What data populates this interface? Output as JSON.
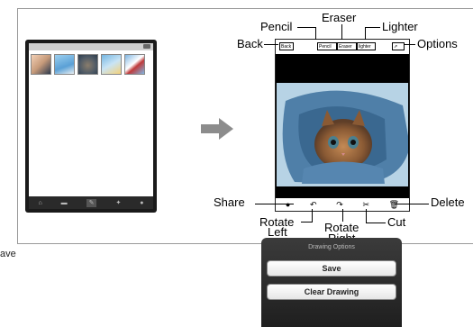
{
  "callouts": {
    "pencil": "Pencil",
    "eraser": "Eraser",
    "lighter": "Lighter",
    "back": "Back",
    "options": "Options",
    "share": "Share",
    "rotate_left": [
      "Rotate",
      "Left"
    ],
    "rotate_right": [
      "Rotate",
      "Right"
    ],
    "cut": "Cut",
    "delete": "Delete"
  },
  "tablet": {
    "back_label": "Back",
    "pencil_label": "Pencil",
    "eraser_label": "Eraser",
    "lighter_label": "lighter"
  },
  "body_text": "ave",
  "drawing_panel": {
    "title": "Drawing Options",
    "save_label": "Save",
    "clear_label": "Clear Drawing"
  },
  "colors": {
    "arrow": "#8c8c8c",
    "panel_bg": "#2b2b2b"
  }
}
